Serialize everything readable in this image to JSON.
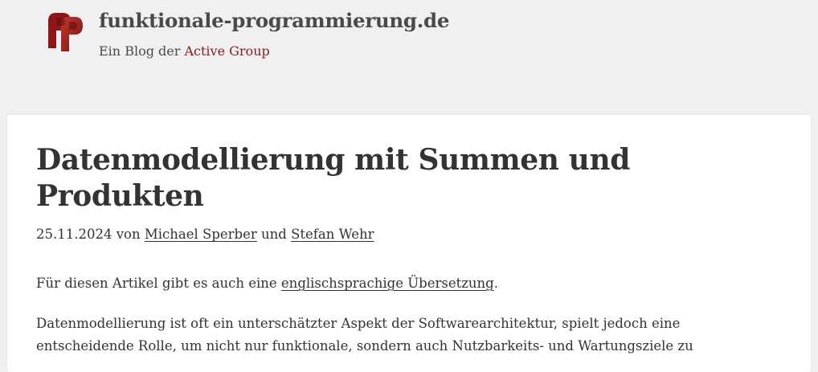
{
  "header": {
    "site_title": "funktionale-programmierung.de",
    "subtitle_prefix": "Ein Blog der ",
    "subtitle_link": "Active Group",
    "logo_icon": "fp-logo-icon",
    "logo_color": "#9b1c1c"
  },
  "article": {
    "title": "Datenmodellierung mit Summen und Produkten",
    "meta": {
      "date": "25.11.2024",
      "by": " von ",
      "author1": "Michael Sperber",
      "and": " und ",
      "author2": "Stefan Wehr"
    },
    "intro_prefix": "Für diesen Artikel gibt es auch eine ",
    "intro_link": "englischsprachige Übersetzung",
    "intro_suffix": ".",
    "paragraph": "Datenmodellierung ist oft ein unterschätzter Aspekt der Softwarearchitektur, spielt jedoch eine entscheidende Rolle, um nicht nur funktionale, sondern auch Nutzbarkeits- und Wartungsziele zu"
  },
  "colors": {
    "link_accent": "#8b1a1a",
    "text": "#333333",
    "background": "#f0f0f0"
  }
}
